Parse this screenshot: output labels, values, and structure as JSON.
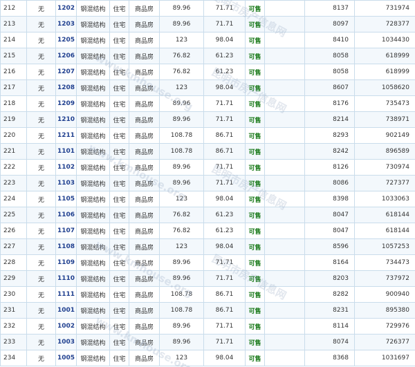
{
  "rows": [
    {
      "no": "212",
      "floor": "无",
      "room": "1202",
      "structure": "钢混结构",
      "use": "住宅",
      "type": "商品房",
      "area": "89.96",
      "inner": "71.71",
      "status": "可售",
      "unit_price": "8137",
      "total": "731974"
    },
    {
      "no": "213",
      "floor": "无",
      "room": "1203",
      "structure": "钢混结构",
      "use": "住宅",
      "type": "商品房",
      "area": "89.96",
      "inner": "71.71",
      "status": "可售",
      "unit_price": "8097",
      "total": "728377"
    },
    {
      "no": "214",
      "floor": "无",
      "room": "1205",
      "structure": "钢混结构",
      "use": "住宅",
      "type": "商品房",
      "area": "123",
      "inner": "98.04",
      "status": "可售",
      "unit_price": "8410",
      "total": "1034430"
    },
    {
      "no": "215",
      "floor": "无",
      "room": "1206",
      "structure": "钢混结构",
      "use": "住宅",
      "type": "商品房",
      "area": "76.82",
      "inner": "61.23",
      "status": "可售",
      "unit_price": "8058",
      "total": "618999"
    },
    {
      "no": "216",
      "floor": "无",
      "room": "1207",
      "structure": "钢混结构",
      "use": "住宅",
      "type": "商品房",
      "area": "76.82",
      "inner": "61.23",
      "status": "可售",
      "unit_price": "8058",
      "total": "618999"
    },
    {
      "no": "217",
      "floor": "无",
      "room": "1208",
      "structure": "钢混结构",
      "use": "住宅",
      "type": "商品房",
      "area": "123",
      "inner": "98.04",
      "status": "可售",
      "unit_price": "8607",
      "total": "1058620"
    },
    {
      "no": "218",
      "floor": "无",
      "room": "1209",
      "structure": "钢混结构",
      "use": "住宅",
      "type": "商品房",
      "area": "89.96",
      "inner": "71.71",
      "status": "可售",
      "unit_price": "8176",
      "total": "735473"
    },
    {
      "no": "219",
      "floor": "无",
      "room": "1210",
      "structure": "钢混结构",
      "use": "住宅",
      "type": "商品房",
      "area": "89.96",
      "inner": "71.71",
      "status": "可售",
      "unit_price": "8214",
      "total": "738971"
    },
    {
      "no": "220",
      "floor": "无",
      "room": "1211",
      "structure": "钢混结构",
      "use": "住宅",
      "type": "商品房",
      "area": "108.78",
      "inner": "86.71",
      "status": "可售",
      "unit_price": "8293",
      "total": "902149"
    },
    {
      "no": "221",
      "floor": "无",
      "room": "1101",
      "structure": "钢混结构",
      "use": "住宅",
      "type": "商品房",
      "area": "108.78",
      "inner": "86.71",
      "status": "可售",
      "unit_price": "8242",
      "total": "896589"
    },
    {
      "no": "222",
      "floor": "无",
      "room": "1102",
      "structure": "钢混结构",
      "use": "住宅",
      "type": "商品房",
      "area": "89.96",
      "inner": "71.71",
      "status": "可售",
      "unit_price": "8126",
      "total": "730974"
    },
    {
      "no": "223",
      "floor": "无",
      "room": "1103",
      "structure": "钢混结构",
      "use": "住宅",
      "type": "商品房",
      "area": "89.96",
      "inner": "71.71",
      "status": "可售",
      "unit_price": "8086",
      "total": "727377"
    },
    {
      "no": "224",
      "floor": "无",
      "room": "1105",
      "structure": "钢混结构",
      "use": "住宅",
      "type": "商品房",
      "area": "123",
      "inner": "98.04",
      "status": "可售",
      "unit_price": "8398",
      "total": "1033063"
    },
    {
      "no": "225",
      "floor": "无",
      "room": "1106",
      "structure": "钢混结构",
      "use": "住宅",
      "type": "商品房",
      "area": "76.82",
      "inner": "61.23",
      "status": "可售",
      "unit_price": "8047",
      "total": "618144"
    },
    {
      "no": "226",
      "floor": "无",
      "room": "1107",
      "structure": "钢混结构",
      "use": "住宅",
      "type": "商品房",
      "area": "76.82",
      "inner": "61.23",
      "status": "可售",
      "unit_price": "8047",
      "total": "618144"
    },
    {
      "no": "227",
      "floor": "无",
      "room": "1108",
      "structure": "钢混结构",
      "use": "住宅",
      "type": "商品房",
      "area": "123",
      "inner": "98.04",
      "status": "可售",
      "unit_price": "8596",
      "total": "1057253"
    },
    {
      "no": "228",
      "floor": "无",
      "room": "1109",
      "structure": "钢混结构",
      "use": "住宅",
      "type": "商品房",
      "area": "89.96",
      "inner": "71.71",
      "status": "可售",
      "unit_price": "8164",
      "total": "734473"
    },
    {
      "no": "229",
      "floor": "无",
      "room": "1110",
      "structure": "钢混结构",
      "use": "住宅",
      "type": "商品房",
      "area": "89.96",
      "inner": "71.71",
      "status": "可售",
      "unit_price": "8203",
      "total": "737972"
    },
    {
      "no": "230",
      "floor": "无",
      "room": "1111",
      "structure": "钢混结构",
      "use": "住宅",
      "type": "商品房",
      "area": "108.78",
      "inner": "86.71",
      "status": "可售",
      "unit_price": "8282",
      "total": "900940"
    },
    {
      "no": "231",
      "floor": "无",
      "room": "1001",
      "structure": "钢混结构",
      "use": "住宅",
      "type": "商品房",
      "area": "108.78",
      "inner": "86.71",
      "status": "可售",
      "unit_price": "8231",
      "total": "895380"
    },
    {
      "no": "232",
      "floor": "无",
      "room": "1002",
      "structure": "钢混结构",
      "use": "住宅",
      "type": "商品房",
      "area": "89.96",
      "inner": "71.71",
      "status": "可售",
      "unit_price": "8114",
      "total": "729976"
    },
    {
      "no": "233",
      "floor": "无",
      "room": "1003",
      "structure": "钢混结构",
      "use": "住宅",
      "type": "商品房",
      "area": "89.96",
      "inner": "71.71",
      "status": "可售",
      "unit_price": "8074",
      "total": "726377"
    },
    {
      "no": "234",
      "floor": "无",
      "room": "1005",
      "structure": "钢混结构",
      "use": "住宅",
      "type": "商品房",
      "area": "123",
      "inner": "98.04",
      "status": "可售",
      "unit_price": "8368",
      "total": "1031697"
    }
  ],
  "watermark": {
    "cn": "昆明市房产信息网",
    "en": "www.kmhouse.org"
  }
}
